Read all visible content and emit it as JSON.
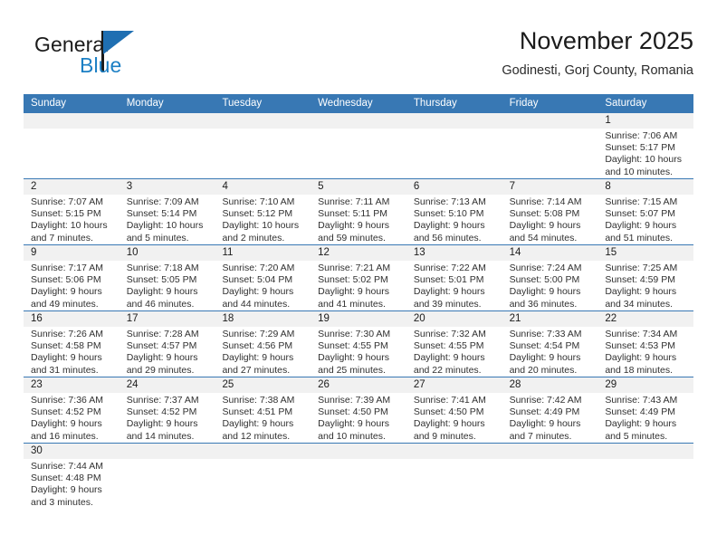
{
  "brand": {
    "name_part1": "General",
    "name_part2": "Blue",
    "triangle_icon": "blue-triangle-logo-mark",
    "color_dark": "#1b1b1b",
    "color_blue": "#1b7fc4"
  },
  "header": {
    "title": "November 2025",
    "subtitle": "Godinesti, Gorj County, Romania"
  },
  "theme": {
    "header_row_bg": "#3878b4",
    "date_band_bg": "#f1f1f1",
    "row_divider": "#3878b4"
  },
  "weekdays": [
    "Sunday",
    "Monday",
    "Tuesday",
    "Wednesday",
    "Thursday",
    "Friday",
    "Saturday"
  ],
  "weeks": [
    [
      {
        "day": "",
        "lines": []
      },
      {
        "day": "",
        "lines": []
      },
      {
        "day": "",
        "lines": []
      },
      {
        "day": "",
        "lines": []
      },
      {
        "day": "",
        "lines": []
      },
      {
        "day": "",
        "lines": []
      },
      {
        "day": "1",
        "lines": [
          "Sunrise: 7:06 AM",
          "Sunset: 5:17 PM",
          "Daylight: 10 hours",
          "and 10 minutes."
        ]
      }
    ],
    [
      {
        "day": "2",
        "lines": [
          "Sunrise: 7:07 AM",
          "Sunset: 5:15 PM",
          "Daylight: 10 hours",
          "and 7 minutes."
        ]
      },
      {
        "day": "3",
        "lines": [
          "Sunrise: 7:09 AM",
          "Sunset: 5:14 PM",
          "Daylight: 10 hours",
          "and 5 minutes."
        ]
      },
      {
        "day": "4",
        "lines": [
          "Sunrise: 7:10 AM",
          "Sunset: 5:12 PM",
          "Daylight: 10 hours",
          "and 2 minutes."
        ]
      },
      {
        "day": "5",
        "lines": [
          "Sunrise: 7:11 AM",
          "Sunset: 5:11 PM",
          "Daylight: 9 hours",
          "and 59 minutes."
        ]
      },
      {
        "day": "6",
        "lines": [
          "Sunrise: 7:13 AM",
          "Sunset: 5:10 PM",
          "Daylight: 9 hours",
          "and 56 minutes."
        ]
      },
      {
        "day": "7",
        "lines": [
          "Sunrise: 7:14 AM",
          "Sunset: 5:08 PM",
          "Daylight: 9 hours",
          "and 54 minutes."
        ]
      },
      {
        "day": "8",
        "lines": [
          "Sunrise: 7:15 AM",
          "Sunset: 5:07 PM",
          "Daylight: 9 hours",
          "and 51 minutes."
        ]
      }
    ],
    [
      {
        "day": "9",
        "lines": [
          "Sunrise: 7:17 AM",
          "Sunset: 5:06 PM",
          "Daylight: 9 hours",
          "and 49 minutes."
        ]
      },
      {
        "day": "10",
        "lines": [
          "Sunrise: 7:18 AM",
          "Sunset: 5:05 PM",
          "Daylight: 9 hours",
          "and 46 minutes."
        ]
      },
      {
        "day": "11",
        "lines": [
          "Sunrise: 7:20 AM",
          "Sunset: 5:04 PM",
          "Daylight: 9 hours",
          "and 44 minutes."
        ]
      },
      {
        "day": "12",
        "lines": [
          "Sunrise: 7:21 AM",
          "Sunset: 5:02 PM",
          "Daylight: 9 hours",
          "and 41 minutes."
        ]
      },
      {
        "day": "13",
        "lines": [
          "Sunrise: 7:22 AM",
          "Sunset: 5:01 PM",
          "Daylight: 9 hours",
          "and 39 minutes."
        ]
      },
      {
        "day": "14",
        "lines": [
          "Sunrise: 7:24 AM",
          "Sunset: 5:00 PM",
          "Daylight: 9 hours",
          "and 36 minutes."
        ]
      },
      {
        "day": "15",
        "lines": [
          "Sunrise: 7:25 AM",
          "Sunset: 4:59 PM",
          "Daylight: 9 hours",
          "and 34 minutes."
        ]
      }
    ],
    [
      {
        "day": "16",
        "lines": [
          "Sunrise: 7:26 AM",
          "Sunset: 4:58 PM",
          "Daylight: 9 hours",
          "and 31 minutes."
        ]
      },
      {
        "day": "17",
        "lines": [
          "Sunrise: 7:28 AM",
          "Sunset: 4:57 PM",
          "Daylight: 9 hours",
          "and 29 minutes."
        ]
      },
      {
        "day": "18",
        "lines": [
          "Sunrise: 7:29 AM",
          "Sunset: 4:56 PM",
          "Daylight: 9 hours",
          "and 27 minutes."
        ]
      },
      {
        "day": "19",
        "lines": [
          "Sunrise: 7:30 AM",
          "Sunset: 4:55 PM",
          "Daylight: 9 hours",
          "and 25 minutes."
        ]
      },
      {
        "day": "20",
        "lines": [
          "Sunrise: 7:32 AM",
          "Sunset: 4:55 PM",
          "Daylight: 9 hours",
          "and 22 minutes."
        ]
      },
      {
        "day": "21",
        "lines": [
          "Sunrise: 7:33 AM",
          "Sunset: 4:54 PM",
          "Daylight: 9 hours",
          "and 20 minutes."
        ]
      },
      {
        "day": "22",
        "lines": [
          "Sunrise: 7:34 AM",
          "Sunset: 4:53 PM",
          "Daylight: 9 hours",
          "and 18 minutes."
        ]
      }
    ],
    [
      {
        "day": "23",
        "lines": [
          "Sunrise: 7:36 AM",
          "Sunset: 4:52 PM",
          "Daylight: 9 hours",
          "and 16 minutes."
        ]
      },
      {
        "day": "24",
        "lines": [
          "Sunrise: 7:37 AM",
          "Sunset: 4:52 PM",
          "Daylight: 9 hours",
          "and 14 minutes."
        ]
      },
      {
        "day": "25",
        "lines": [
          "Sunrise: 7:38 AM",
          "Sunset: 4:51 PM",
          "Daylight: 9 hours",
          "and 12 minutes."
        ]
      },
      {
        "day": "26",
        "lines": [
          "Sunrise: 7:39 AM",
          "Sunset: 4:50 PM",
          "Daylight: 9 hours",
          "and 10 minutes."
        ]
      },
      {
        "day": "27",
        "lines": [
          "Sunrise: 7:41 AM",
          "Sunset: 4:50 PM",
          "Daylight: 9 hours",
          "and 9 minutes."
        ]
      },
      {
        "day": "28",
        "lines": [
          "Sunrise: 7:42 AM",
          "Sunset: 4:49 PM",
          "Daylight: 9 hours",
          "and 7 minutes."
        ]
      },
      {
        "day": "29",
        "lines": [
          "Sunrise: 7:43 AM",
          "Sunset: 4:49 PM",
          "Daylight: 9 hours",
          "and 5 minutes."
        ]
      }
    ],
    [
      {
        "day": "30",
        "lines": [
          "Sunrise: 7:44 AM",
          "Sunset: 4:48 PM",
          "Daylight: 9 hours",
          "and 3 minutes."
        ]
      },
      {
        "day": "",
        "lines": []
      },
      {
        "day": "",
        "lines": []
      },
      {
        "day": "",
        "lines": []
      },
      {
        "day": "",
        "lines": []
      },
      {
        "day": "",
        "lines": []
      },
      {
        "day": "",
        "lines": []
      }
    ]
  ]
}
